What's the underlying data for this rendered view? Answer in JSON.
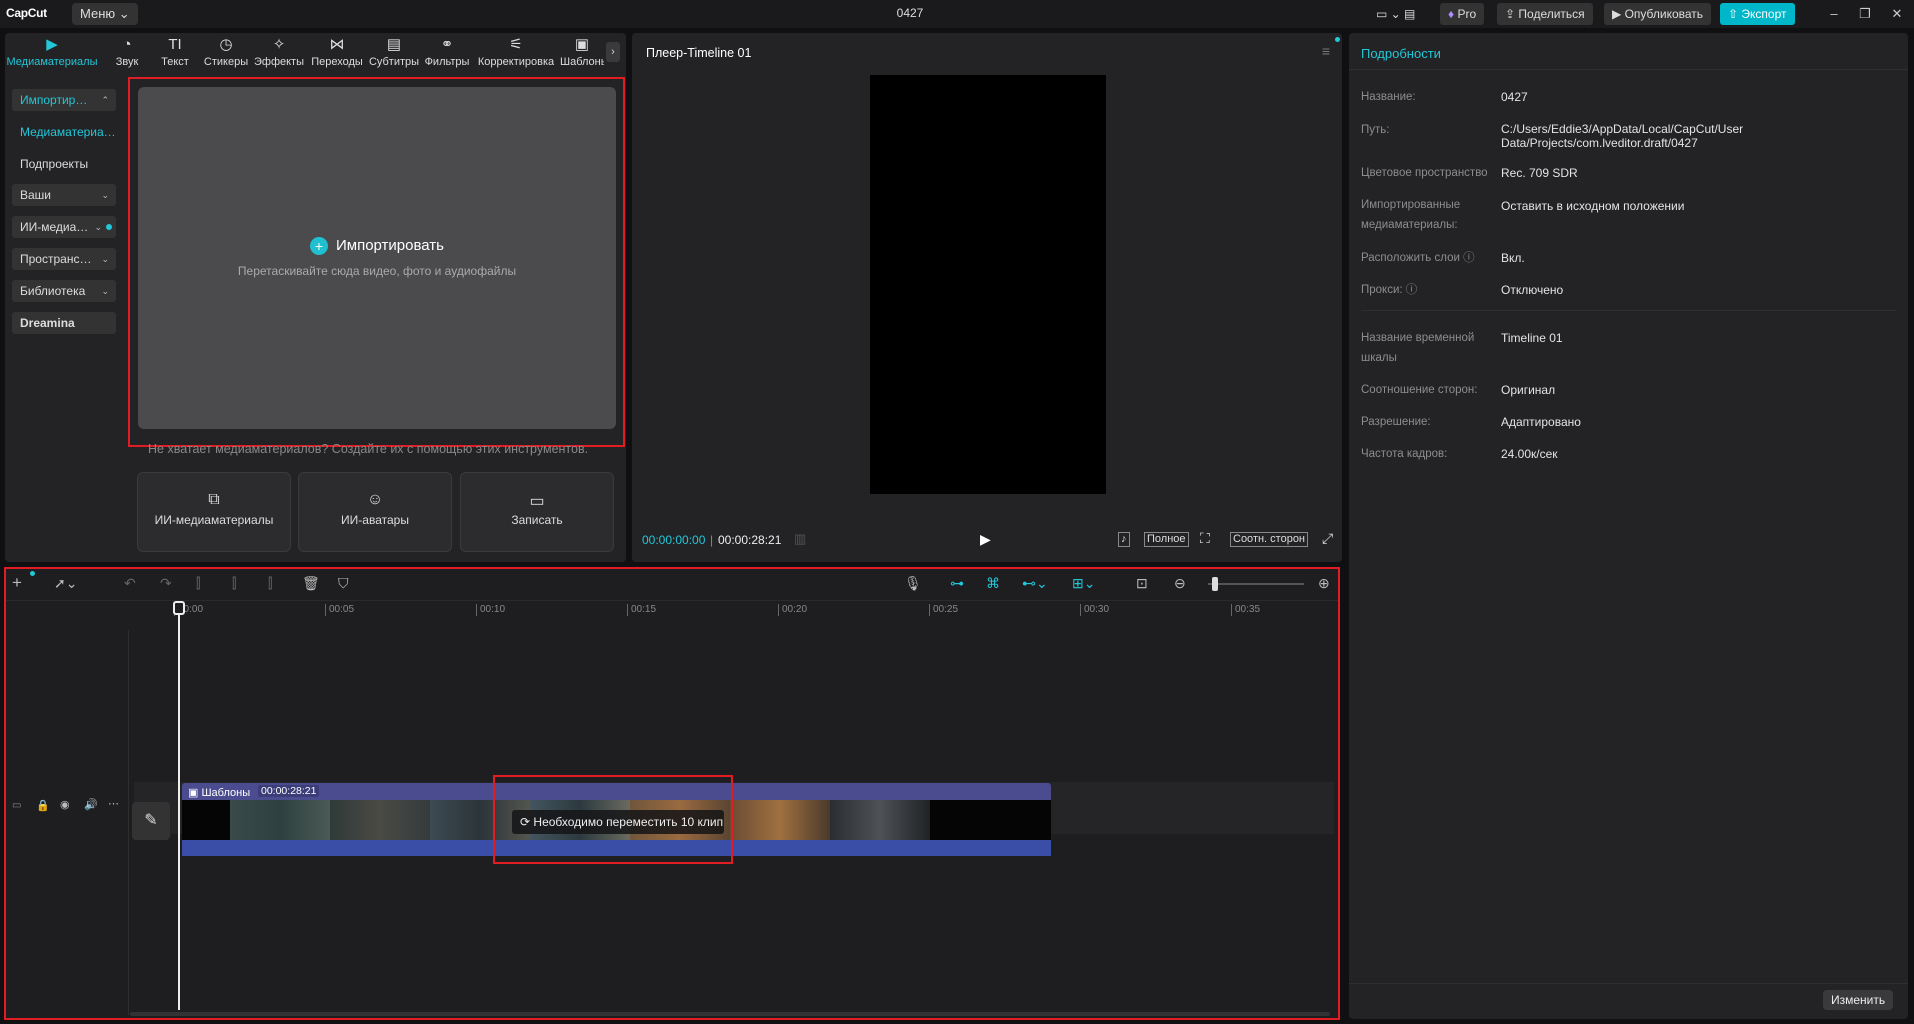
{
  "topbar": {
    "logo": "CapCut",
    "menu_label": "Меню",
    "title": "0427",
    "pro_label": "Pro",
    "share_label": "Поделиться",
    "publish_label": "Опубликовать",
    "export_label": "Экспорт"
  },
  "tabs": [
    {
      "label": "Медиаматериалы",
      "icon": "media-icon"
    },
    {
      "label": "Звук",
      "icon": "audio-icon"
    },
    {
      "label": "Текст",
      "icon": "text-icon"
    },
    {
      "label": "Стикеры",
      "icon": "sticker-icon"
    },
    {
      "label": "Эффекты",
      "icon": "effects-icon"
    },
    {
      "label": "Переходы",
      "icon": "transitions-icon"
    },
    {
      "label": "Субтитры",
      "icon": "subtitles-icon"
    },
    {
      "label": "Фильтры",
      "icon": "filters-icon"
    },
    {
      "label": "Корректировка",
      "icon": "adjust-icon"
    },
    {
      "label": "Шаблоны",
      "icon": "templates-icon"
    }
  ],
  "sidenav": [
    {
      "label": "Импортир…"
    },
    {
      "label": "Медиаматериа…"
    },
    {
      "label": "Подпроекты"
    },
    {
      "label": "Ваши"
    },
    {
      "label": "ИИ-медиа…"
    },
    {
      "label": "Пространс…"
    },
    {
      "label": "Библиотека"
    },
    {
      "label": "Dreamina"
    }
  ],
  "import": {
    "button_label": "Импортировать",
    "hint": "Перетаскивайте сюда видео, фото и аудиофайлы"
  },
  "ai_hint": "Не хватает медиаматериалов? Создайте их с помощью этих инструментов.",
  "ai_cards": [
    {
      "label": "ИИ-медиаматериалы"
    },
    {
      "label": "ИИ-аватары"
    },
    {
      "label": "Записать"
    }
  ],
  "player": {
    "title": "Плеер-Timeline 01",
    "time_current": "00:00:00:00",
    "time_total": "00:00:28:21",
    "full_label": "Полное",
    "ratio_label": "Соотн. сторон"
  },
  "details": {
    "title": "Подробности",
    "rows": [
      {
        "label": "Название:",
        "value": "0427"
      },
      {
        "label": "Путь:",
        "value": "C:/Users/Eddie3/AppData/Local/CapCut/User Data/Projects/com.lveditor.draft/0427"
      },
      {
        "label": "Цветовое пространство",
        "value": "Rec. 709 SDR"
      },
      {
        "label": "Импортированные медиаматериалы:",
        "value": "Оставить в исходном положении"
      },
      {
        "label": "Расположить слои ⓘ",
        "value": "Вкл."
      },
      {
        "label": "Прокси: ⓘ",
        "value": "Отключено"
      },
      {
        "label": "Название временной шкалы",
        "value": "Timeline 01"
      },
      {
        "label": "Соотношение сторон:",
        "value": "Оригинал"
      },
      {
        "label": "Разрешение:",
        "value": "Адаптировано"
      },
      {
        "label": "Частота кадров:",
        "value": "24.00к/сек"
      }
    ],
    "edit_label": "Изменить"
  },
  "timeline": {
    "ticks": [
      "00:00",
      "00:05",
      "00:10",
      "00:15",
      "00:20",
      "00:25",
      "00:30",
      "00:35"
    ],
    "clip_label": "Шаблоны",
    "clip_duration": "00:00:28:21",
    "move_message": "Необходимо переместить 10 клип"
  },
  "colors": {
    "accent": "#22c7d8",
    "highlight_box": "#e01d23",
    "clip": "#4a4c8f"
  }
}
